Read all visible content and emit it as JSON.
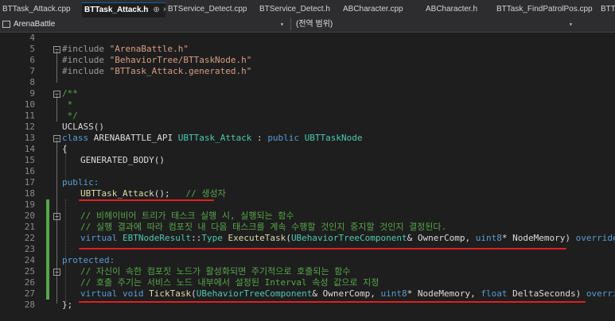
{
  "tabs": [
    {
      "label": "BTTask_Attack.cpp"
    },
    {
      "label": "BTTask_Attack.h"
    },
    {
      "label": "BTService_Detect.cpp"
    },
    {
      "label": "BTService_Detect.h"
    },
    {
      "label": "ABCharacter.cpp"
    },
    {
      "label": "ABCharacter.h"
    },
    {
      "label": "BTTask_FindPatrolPos.cpp"
    },
    {
      "label": "BTTa"
    }
  ],
  "active_tab_pin": "⊕",
  "active_tab_close": "×",
  "navbar": {
    "project": "ArenaBattle",
    "scope": "(전역 범위)",
    "dropdown": "▾"
  },
  "line_numbers": [
    "4",
    "5",
    "6",
    "7",
    "8",
    "9",
    "10",
    "11",
    "12",
    "13",
    "14",
    "15",
    "16",
    "17",
    "18",
    "19",
    "20",
    "21",
    "22",
    "23",
    "24",
    "25",
    "26",
    "27",
    "28"
  ],
  "code": {
    "l5_a": "#include ",
    "l5_b": "\"ArenaBattle.h\"",
    "l6_a": "#include ",
    "l6_b": "\"BehaviorTree/BTTaskNode.h\"",
    "l7_a": "#include ",
    "l7_b": "\"BTTask_Attack.generated.h\"",
    "l9": "/**",
    "l10": " *",
    "l11": " */",
    "l12": "UCLASS()",
    "l13_class": "class",
    "l13_api": "ARENABATTLE_API",
    "l13_name": "UBTTask_Attack",
    "l13_colon": " : ",
    "l13_pub": "public",
    "l13_base": "UBTTaskNode",
    "l14": "{",
    "l15": "GENERATED_BODY()",
    "l17": "public:",
    "l18_fn": "UBTTask_Attack",
    "l18_rest": "();   ",
    "l18_cm": "// 생성자",
    "l20": "// 비헤이비어 트리가 태스크 실행 시, 실행되는 함수",
    "l21": "// 실행 결과에 따라 컴포짓 내 다음 태스크를 계속 수행할 것인지 중지할 것인지 결정된다.",
    "l22_virtual": "virtual",
    "l22_ret": "EBTNodeResult",
    "l22_sep": "::",
    "l22_type": "Type",
    "l22_fn": "ExecuteTask",
    "l22_p1": "UBehaviorTreeComponent",
    "l22_p1n": "& OwnerComp, ",
    "l22_p2": "uint8",
    "l22_p2n": "* NodeMemory) ",
    "l22_ov": "override",
    "l22_end": ";",
    "l24": "protected:",
    "l25": "// 자신이 속한 컴포짓 노드가 활성화되면 주기적으로 호출되는 함수",
    "l26": "// 호출 주기는 서비스 노드 내부에서 설정된 Interval 속성 값으로 지정",
    "l27_virtual": "virtual",
    "l27_void": "void",
    "l27_fn": "TickTask",
    "l27_p1": "UBehaviorTreeComponent",
    "l27_p1n": "& OwnerComp, ",
    "l27_p2": "uint8",
    "l27_p2n": "* NodeMemory, ",
    "l27_p3": "float",
    "l27_p3n": " DeltaSeconds) ",
    "l27_ov": "override",
    "l27_end": ";",
    "l28": "};"
  },
  "colors": {
    "keyword": "#569cd6",
    "type": "#4ec9b0",
    "string": "#d69d85",
    "comment": "#57a64a",
    "macro": "#bd63c5",
    "annotation": "#e02020"
  }
}
